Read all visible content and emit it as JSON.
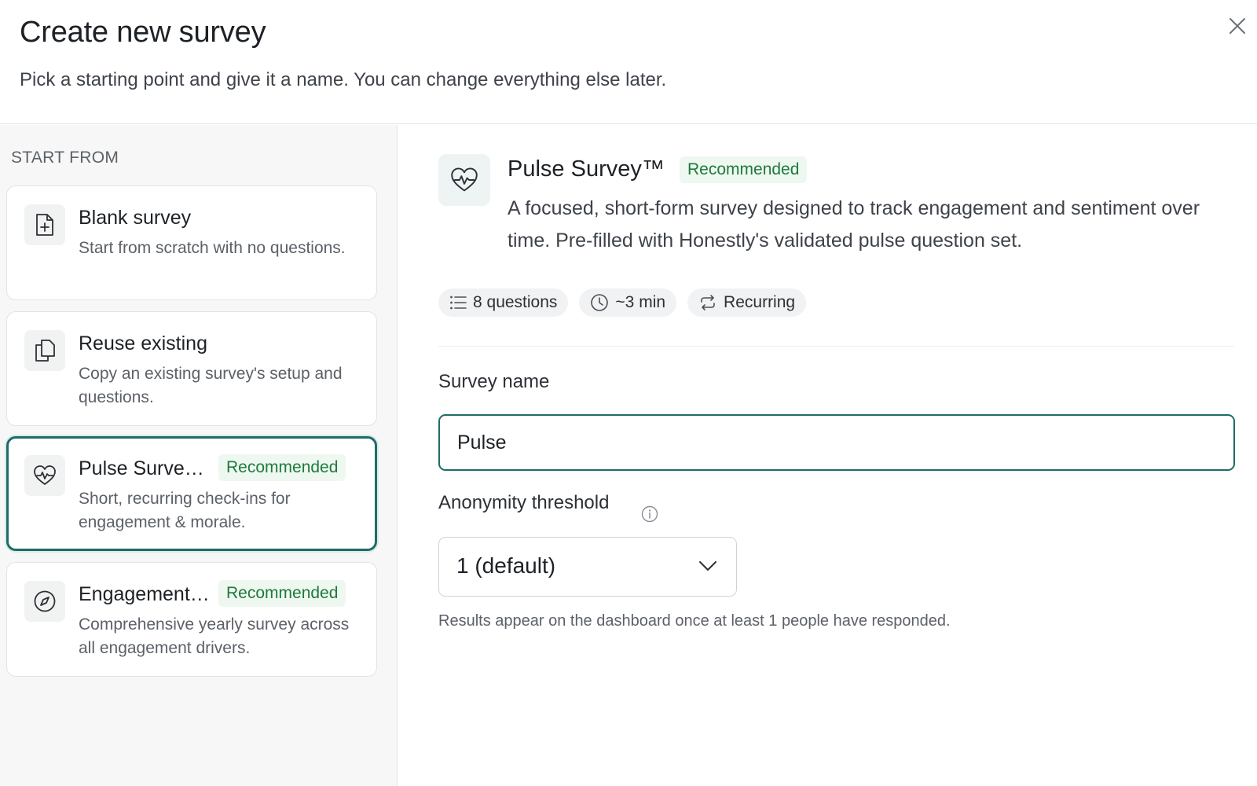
{
  "header": {
    "title": "Create new survey",
    "subtitle": "Pick a starting point and give it a name. You can change everything else later.",
    "close_icon": "close-icon"
  },
  "sidebar": {
    "heading": "START FROM",
    "cards": [
      {
        "title": "Blank survey",
        "description": "Start from scratch with no questions.",
        "icon": "file-plus-icon",
        "badge": "",
        "selected": false
      },
      {
        "title": "Reuse existing",
        "description": "Copy an existing survey's setup and questions.",
        "icon": "copy-icon",
        "badge": "",
        "selected": false
      },
      {
        "title": "Pulse Survey™",
        "description": "Short, recurring check-ins for engagement & morale.",
        "icon": "heart-pulse-icon",
        "badge": "Recommended",
        "selected": true
      },
      {
        "title": "Engagement Survey",
        "description": "Comprehensive yearly survey across all engagement drivers.",
        "icon": "compass-icon",
        "badge": "Recommended",
        "selected": false
      }
    ]
  },
  "detail": {
    "icon": "heart-pulse-icon",
    "title": "Pulse Survey™",
    "badge": "Recommended",
    "description": "A focused, short-form survey designed to track engagement and sentiment over time. Pre-filled with Honestly's validated pulse question set.",
    "chips": [
      {
        "icon": "list-icon",
        "label": "8 questions"
      },
      {
        "icon": "clock-icon",
        "label": "~3 min"
      },
      {
        "icon": "repeat-icon",
        "label": "Recurring"
      }
    ]
  },
  "form": {
    "name_label": "Survey name",
    "name_value": "Pulse",
    "threshold_label": "Anonymity threshold",
    "threshold_value": "1 (default)",
    "threshold_help": "Results appear on the dashboard once at least 1 people have responded."
  },
  "colors": {
    "accent": "#1f6b66",
    "badge_text": "#1e7a3c",
    "badge_bg": "#eef7f0"
  }
}
